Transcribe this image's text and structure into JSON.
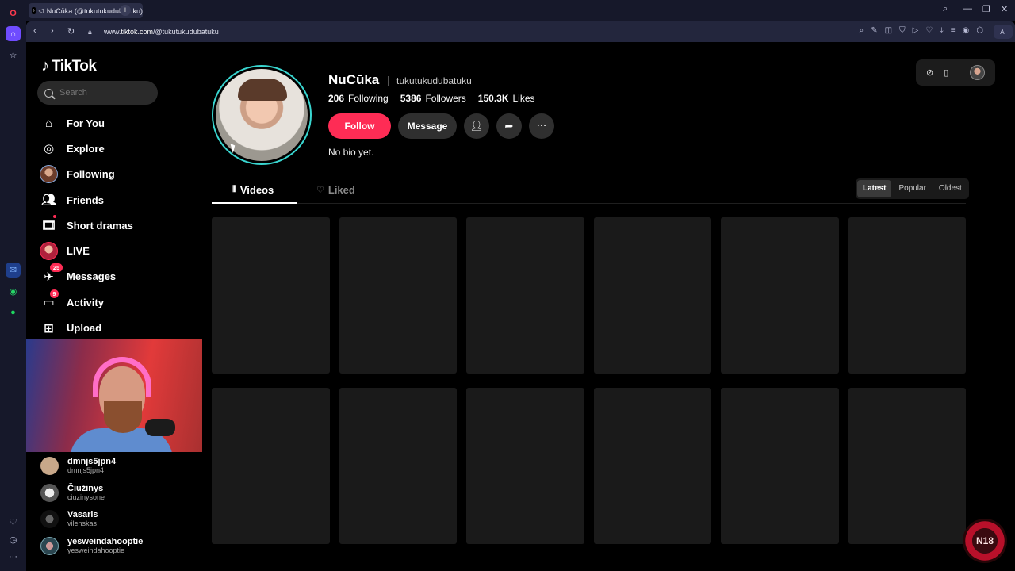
{
  "browser": {
    "tab_title": "NuCūka (@tukutukudubatuku)",
    "url_prefix": "www.",
    "url_host": "tiktok.com",
    "url_path": "/@tukutukudubatuku",
    "ai_label": "AI",
    "new_tab_label": "+"
  },
  "tiktok": {
    "logo_text": "TikTok",
    "search": {
      "placeholder": "Search"
    },
    "nav": [
      {
        "label": "For You"
      },
      {
        "label": "Explore"
      },
      {
        "label": "Following"
      },
      {
        "label": "Friends"
      },
      {
        "label": "Short dramas"
      },
      {
        "label": "LIVE"
      },
      {
        "label": "Messages",
        "badge": "25"
      },
      {
        "label": "Activity",
        "badge": "9"
      },
      {
        "label": "Upload"
      }
    ],
    "accounts": [
      {
        "name": "dmnjs5jpn4",
        "handle": "dmnjs5jpn4",
        "color": "#c8a88a"
      },
      {
        "name": "Čiužinys",
        "handle": "ciuzinysone",
        "color": "#d8d8d8"
      },
      {
        "name": "Vasaris",
        "handle": "vilenskas",
        "color": "#2a2a2a"
      },
      {
        "name": "yesweindahooptie",
        "handle": "yesweindahooptie",
        "color": "#7aa6b0"
      }
    ]
  },
  "profile": {
    "name": "NuCūka",
    "handle": "tukutukudubatuku",
    "following_count": "206",
    "following_label": "Following",
    "followers_count": "5386",
    "followers_label": "Followers",
    "likes_count": "150.3K",
    "likes_label": "Likes",
    "follow_label": "Follow",
    "message_label": "Message",
    "bio": "No bio yet.",
    "tabs": {
      "videos": "Videos",
      "liked": "Liked"
    },
    "sort": {
      "latest": "Latest",
      "popular": "Popular",
      "oldest": "Oldest"
    },
    "video_placeholders": 12
  },
  "overlay": {
    "watermark": "N18"
  },
  "colors": {
    "accent": "#fe2c55",
    "avatar_ring": "#39d6d0",
    "tile": "#1a1a1a"
  }
}
